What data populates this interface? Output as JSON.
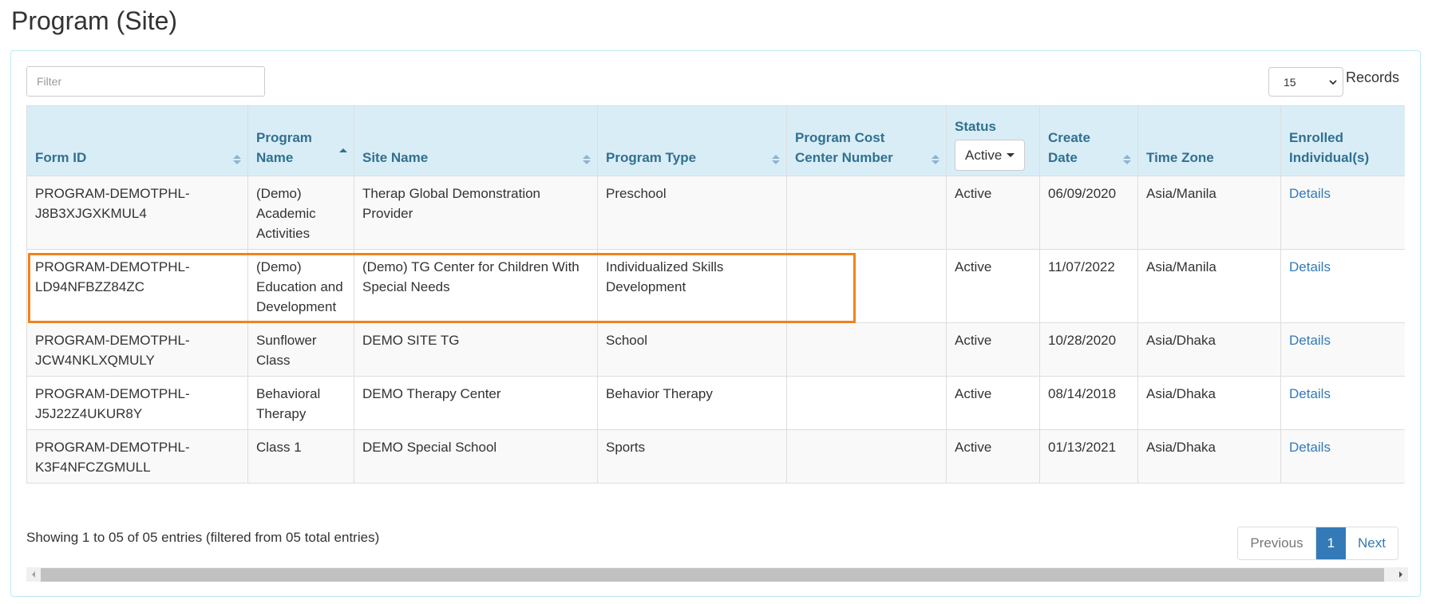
{
  "page": {
    "title": "Program (Site)"
  },
  "filter": {
    "placeholder": "Filter",
    "value": ""
  },
  "records": {
    "selected": "15",
    "label": "Records"
  },
  "table": {
    "columns": [
      {
        "key": "form_id",
        "label": "Form ID",
        "sort": "both"
      },
      {
        "key": "program_name",
        "label": "Program Name",
        "sort": "asc"
      },
      {
        "key": "site_name",
        "label": "Site Name",
        "sort": "both"
      },
      {
        "key": "program_type",
        "label": "Program Type",
        "sort": "both"
      },
      {
        "key": "cost_center",
        "label": "Program Cost Center Number",
        "sort": "both"
      },
      {
        "key": "status",
        "label": "Status",
        "filter_value": "Active"
      },
      {
        "key": "create_date",
        "label": "Create Date",
        "sort": "both"
      },
      {
        "key": "time_zone",
        "label": "Time Zone"
      },
      {
        "key": "enrolled",
        "label": "Enrolled Individual(s)"
      }
    ],
    "rows": [
      {
        "form_id": "PROGRAM-DEMOTPHL-J8B3XJGXKMUL4",
        "program_name": "(Demo) Academic Activities",
        "site_name": "Therap Global Demonstration Provider",
        "program_type": "Preschool",
        "cost_center": "",
        "status": "Active",
        "create_date": "06/09/2020",
        "time_zone": "Asia/Manila",
        "enrolled": "Details"
      },
      {
        "form_id": "PROGRAM-DEMOTPHL-LD94NFBZZ84ZC",
        "program_name": "(Demo) Education and Development",
        "site_name": "(Demo) TG Center for Children With Special Needs",
        "program_type": "Individualized Skills Development",
        "cost_center": "",
        "status": "Active",
        "create_date": "11/07/2022",
        "time_zone": "Asia/Manila",
        "enrolled": "Details",
        "highlighted": true
      },
      {
        "form_id": "PROGRAM-DEMOTPHL-JCW4NKLXQMULY",
        "program_name": "Sunflower Class",
        "site_name": "DEMO SITE TG",
        "program_type": "School",
        "cost_center": "",
        "status": "Active",
        "create_date": "10/28/2020",
        "time_zone": "Asia/Dhaka",
        "enrolled": "Details"
      },
      {
        "form_id": "PROGRAM-DEMOTPHL-J5J22Z4UKUR8Y",
        "program_name": "Behavioral Therapy",
        "site_name": "DEMO Therapy Center",
        "program_type": "Behavior Therapy",
        "cost_center": "",
        "status": "Active",
        "create_date": "08/14/2018",
        "time_zone": "Asia/Dhaka",
        "enrolled": "Details"
      },
      {
        "form_id": "PROGRAM-DEMOTPHL-K3F4NFCZGMULL",
        "program_name": "Class 1",
        "site_name": "DEMO Special School",
        "program_type": "Sports",
        "cost_center": "",
        "status": "Active",
        "create_date": "01/13/2021",
        "time_zone": "Asia/Dhaka",
        "enrolled": "Details"
      }
    ]
  },
  "footer": {
    "info": "Showing 1 to 05 of 05 entries (filtered from 05 total entries)",
    "pagination": {
      "previous": "Previous",
      "current": "1",
      "next": "Next"
    }
  },
  "colors": {
    "header_bg": "#d9edf7",
    "header_text": "#31708f",
    "link": "#337ab7",
    "highlight": "#f0821e",
    "panel_border": "#bce8f1"
  }
}
